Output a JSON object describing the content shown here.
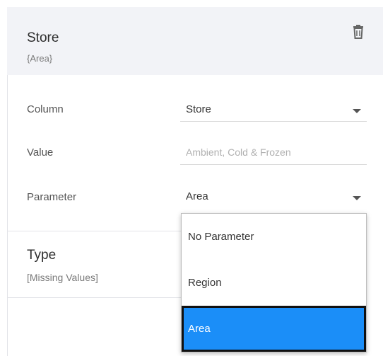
{
  "header": {
    "title": "Store",
    "subtitle": "{Area}",
    "delete_icon": "trash-icon"
  },
  "form": {
    "column": {
      "label": "Column",
      "value": "Store"
    },
    "value": {
      "label": "Value",
      "placeholder": "Ambient, Cold & Frozen"
    },
    "parameter": {
      "label": "Parameter",
      "value": "Area"
    }
  },
  "type_section": {
    "title": "Type",
    "subtitle": "[Missing Values]"
  },
  "dropdown": {
    "options": [
      "No Parameter",
      "Region",
      "Area"
    ],
    "selected": "Area",
    "selected_color": "#1b8ef8"
  }
}
